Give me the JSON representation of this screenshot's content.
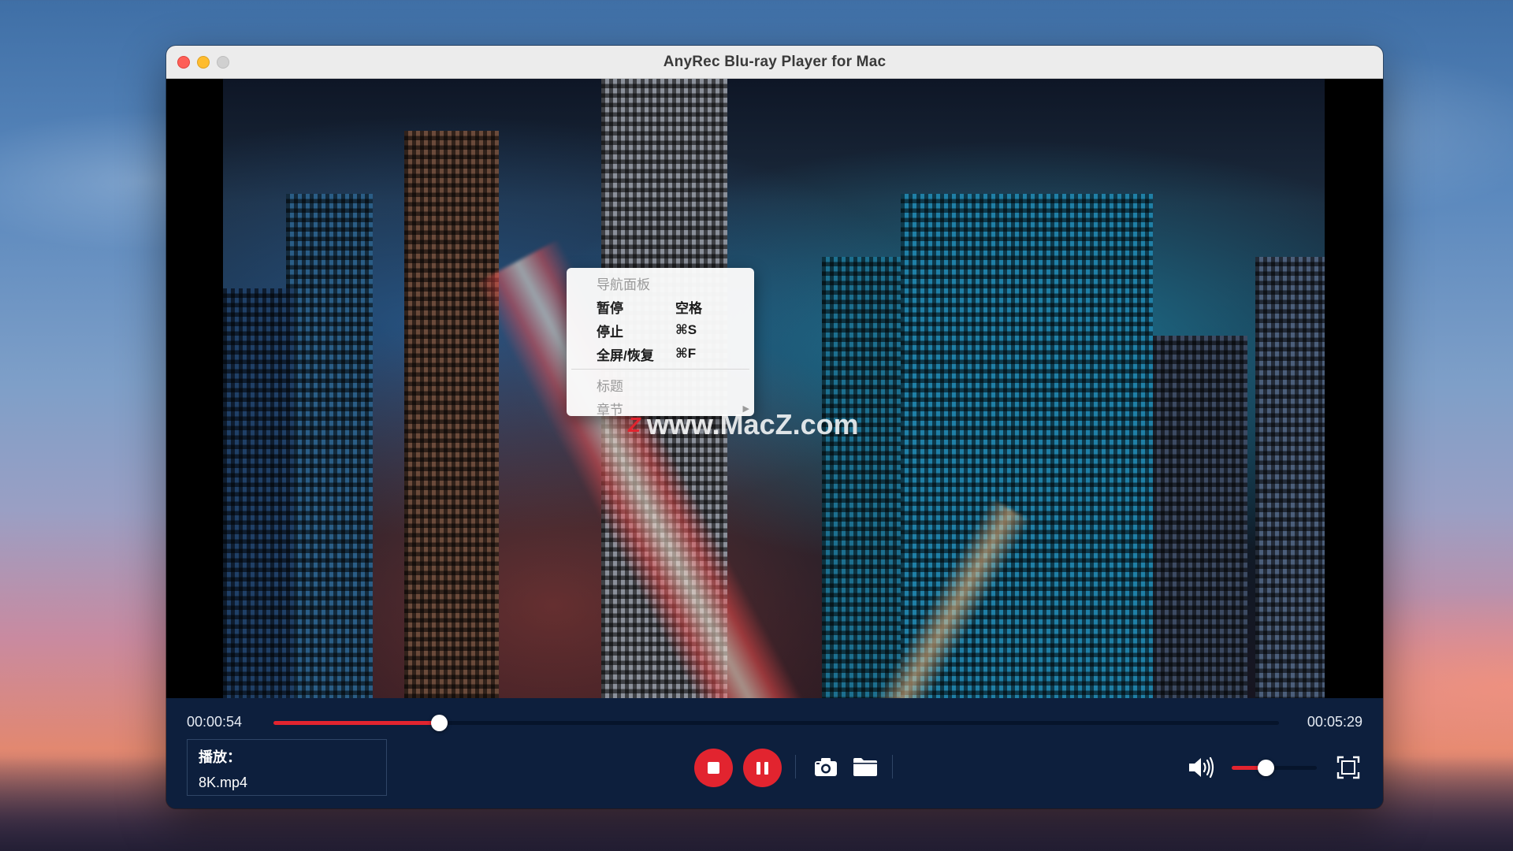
{
  "window": {
    "title": "AnyRec Blu-ray Player for Mac"
  },
  "context_menu": {
    "items": [
      {
        "label": "导航面板",
        "shortcut": "",
        "disabled": true
      },
      {
        "label": "暂停",
        "shortcut": "空格",
        "disabled": false
      },
      {
        "label": "停止",
        "shortcut": "⌘S",
        "disabled": false
      },
      {
        "label": "全屏/恢复",
        "shortcut": "⌘F",
        "disabled": false
      },
      {
        "label": "标题",
        "shortcut": "",
        "disabled": true
      },
      {
        "label": "章节",
        "shortcut": "",
        "disabled": true,
        "submenu": true
      }
    ]
  },
  "watermark": {
    "logo": "Z",
    "text": "www.MacZ.com"
  },
  "player": {
    "current_time": "00:00:54",
    "total_time": "00:05:29",
    "progress_fraction": 0.1642,
    "volume_fraction": 0.4,
    "status_label": "播放：",
    "file_name": "8K.mp4"
  },
  "colors": {
    "accent": "#e2242f",
    "panel": "#0d1f3d"
  },
  "icons": [
    "close-icon",
    "minimize-icon",
    "zoom-icon",
    "stop-icon",
    "pause-icon",
    "camera-icon",
    "folder-icon",
    "speaker-icon",
    "fullscreen-icon"
  ]
}
